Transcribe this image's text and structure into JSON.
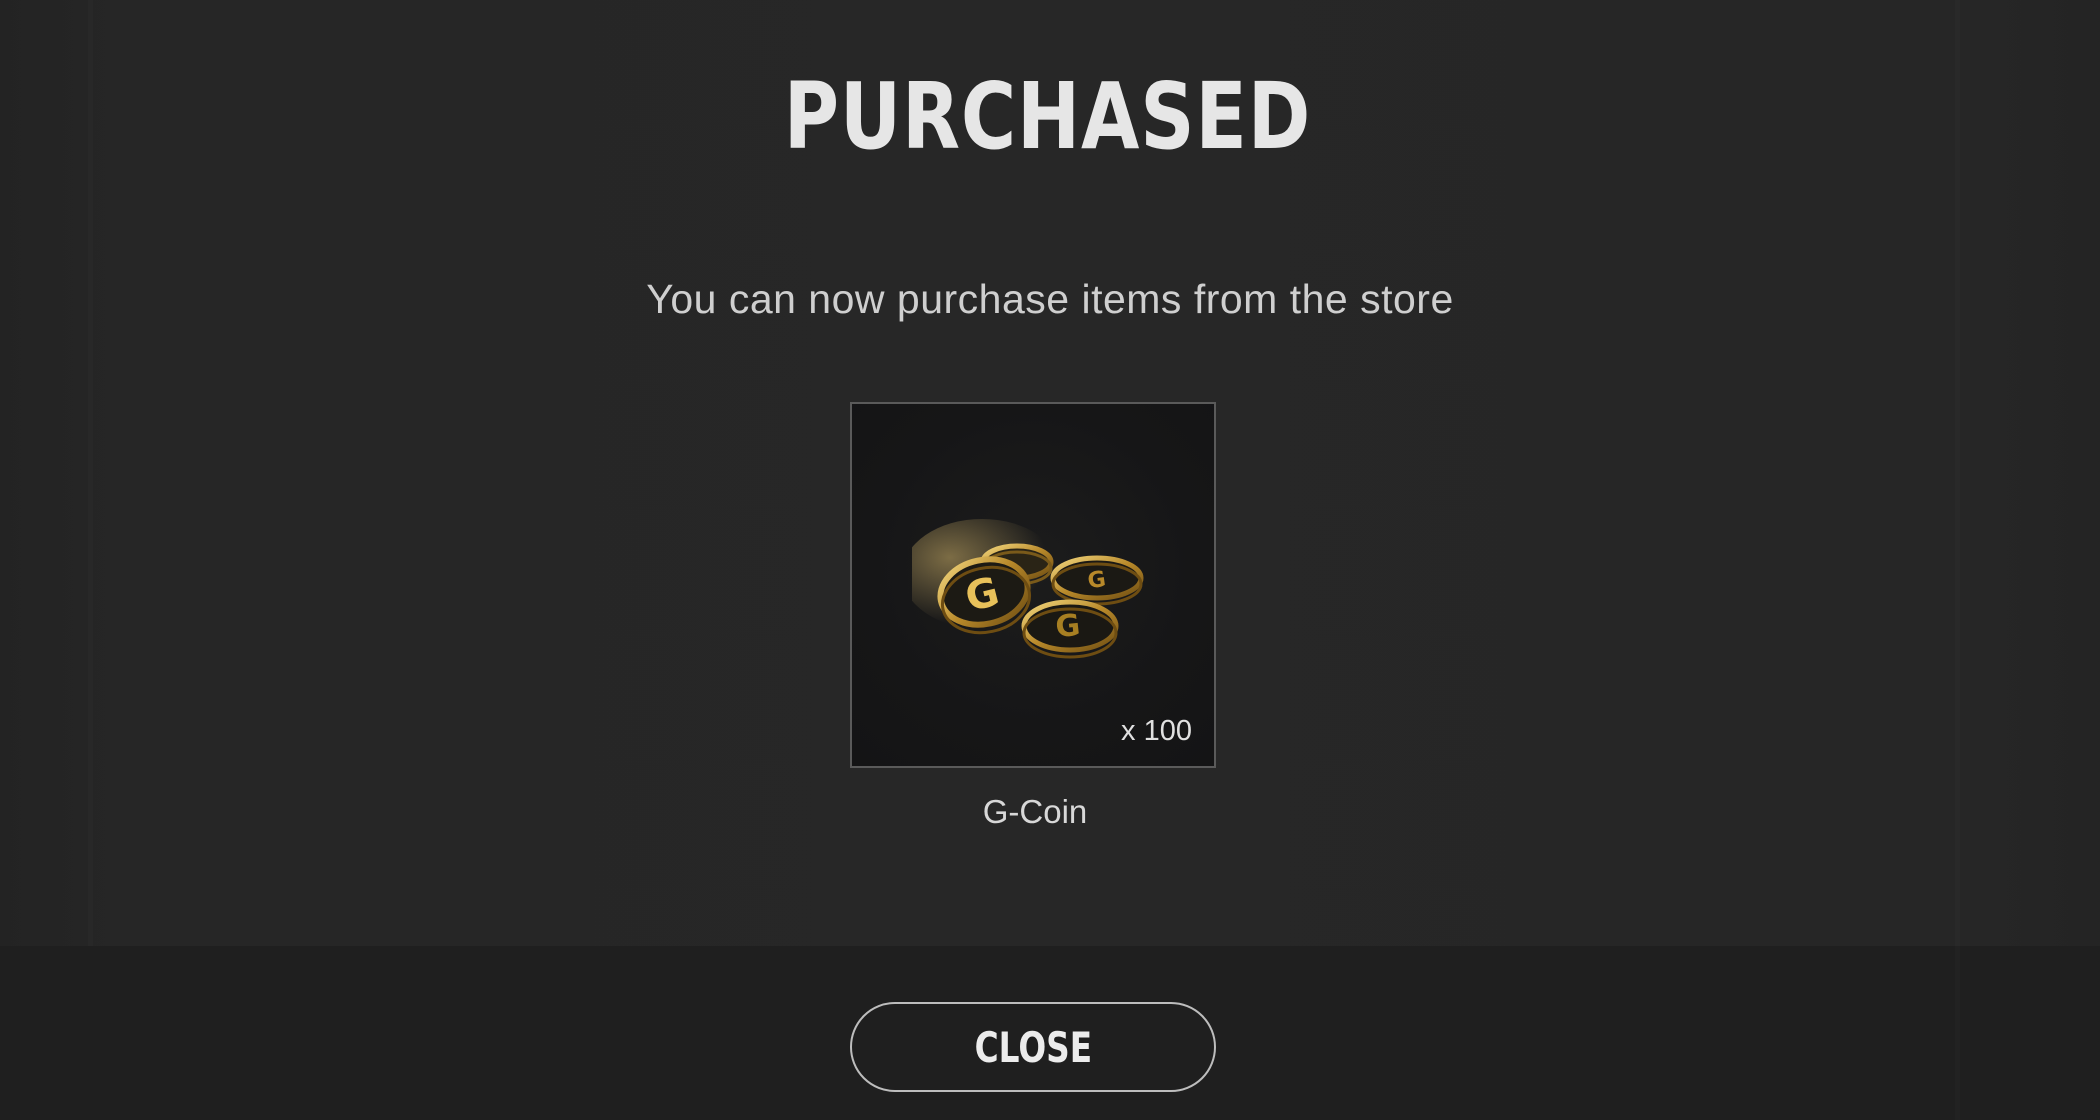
{
  "dialog": {
    "title": "PURCHASED",
    "message": "You can now purchase items from the store"
  },
  "item": {
    "name": "G-Coin",
    "quantity": "x 100",
    "icon": "g-coin-stack-icon",
    "coin_color": "#c9a23a"
  },
  "footer": {
    "close_label": "CLOSE"
  },
  "colors": {
    "background": "#262626",
    "footer_background": "#1f1f1f",
    "card_background": "#161617",
    "text_primary": "#e6e6e6"
  }
}
